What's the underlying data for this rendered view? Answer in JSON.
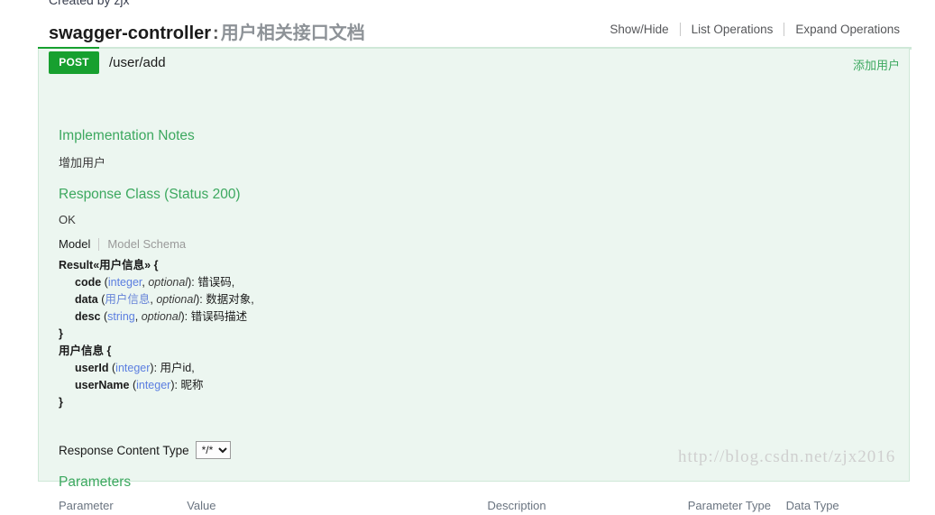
{
  "page": {
    "created_by": "Created by zjx",
    "watermark": "http://blog.csdn.net/zjx2016"
  },
  "resource": {
    "name": "swagger-controller",
    "separator": ":",
    "description": "用户相关接口文档",
    "options": [
      {
        "label": "Show/Hide",
        "name": "show-hide"
      },
      {
        "label": "List Operations",
        "name": "list-operations"
      },
      {
        "label": "Expand Operations",
        "name": "expand-operations"
      }
    ]
  },
  "operation": {
    "method": "POST",
    "path": "/user/add",
    "summary": "添加用户",
    "method_color": "#17a02f",
    "summary_color": "#3ca85f",
    "implementation_notes": {
      "heading": "Implementation Notes",
      "body": "增加用户"
    },
    "response_class": {
      "heading": "Response Class (Status 200)",
      "body": "OK"
    },
    "model_tabs": [
      {
        "label": "Model",
        "active": true
      },
      {
        "label": "Model Schema",
        "active": false
      }
    ],
    "model_signature": {
      "result_title": "Result«用户信息» {",
      "result_fields": [
        {
          "name": "code",
          "type": "integer",
          "optional": "optional",
          "desc": "错误码,",
          "type_is_link": false
        },
        {
          "name": "data",
          "type": "用户信息",
          "optional": "optional",
          "desc": "数据对象,",
          "type_is_link": true
        },
        {
          "name": "desc",
          "type": "string",
          "optional": "optional",
          "desc": "错误码描述",
          "type_is_link": false
        }
      ],
      "result_close": "}",
      "user_title": "用户信息 {",
      "user_fields": [
        {
          "name": "userId",
          "type": "integer",
          "optional": "",
          "desc": "用户id,",
          "type_is_link": false
        },
        {
          "name": "userName",
          "type": "integer",
          "optional": "",
          "desc": "昵称",
          "type_is_link": false
        }
      ],
      "user_close": "}"
    },
    "response_content_type": {
      "label": "Response Content Type",
      "value": "*/*",
      "options": [
        "*/*"
      ]
    },
    "parameters": {
      "heading": "Parameters",
      "columns": [
        "Parameter",
        "Value",
        "Description",
        "Parameter Type",
        "Data Type"
      ],
      "rows": []
    }
  }
}
